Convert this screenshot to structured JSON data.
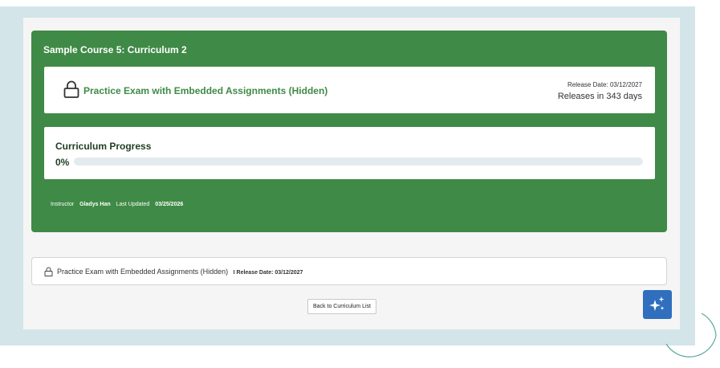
{
  "course": {
    "title": "Sample Course 5: Curriculum 2"
  },
  "assignment": {
    "icon": "lock-icon",
    "title": "Practice Exam with Embedded Assignments (Hidden)",
    "release_date": "Release Date: 03/12/2027",
    "releases_in": "Releases in 343 days"
  },
  "progress": {
    "label": "Curriculum Progress",
    "percent_text": "0%",
    "value": 0
  },
  "footer": {
    "instructor_label": "Instructor",
    "instructor_name": "Gladys Han",
    "updated_label": "Last Updated",
    "updated_date": "03/25/2026"
  },
  "list": {
    "item_text": "Practice Exam with Embedded Assignments (Hidden)",
    "item_release": "I Release Date: 03/12/2027"
  },
  "buttons": {
    "back_label": "Back to Curriculum List",
    "ai_icon": "sparkle-icon"
  },
  "colors": {
    "card_green": "#3f8a46",
    "frame_teal": "#d3e5e9",
    "ai_blue": "#2f6fbd"
  }
}
